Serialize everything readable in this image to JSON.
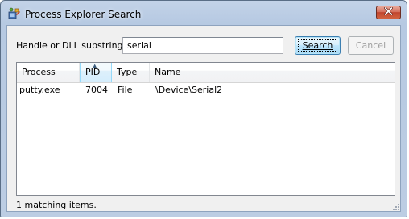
{
  "window": {
    "title": "Process Explorer Search"
  },
  "icons": {
    "app": "process-explorer-icon",
    "close": "close-icon",
    "sort": "sort-ascending-icon",
    "grip": "resize-grip-icon"
  },
  "search": {
    "label": "Handle or DLL substring:",
    "value": "serial",
    "search_button": "Search",
    "cancel_button": "Cancel"
  },
  "results": {
    "columns": [
      {
        "label": "Process"
      },
      {
        "label": "PID",
        "sorted": "ascending"
      },
      {
        "label": "Type"
      },
      {
        "label": "Name"
      }
    ],
    "rows": [
      {
        "process": "putty.exe",
        "pid": "7004",
        "type": "File",
        "name": "\\Device\\Serial2"
      }
    ]
  },
  "status": "1 matching items.",
  "colors": {
    "accent": "#3c7fb1",
    "title_bar": "#b6c9e2",
    "close_button": "#c0442e"
  }
}
